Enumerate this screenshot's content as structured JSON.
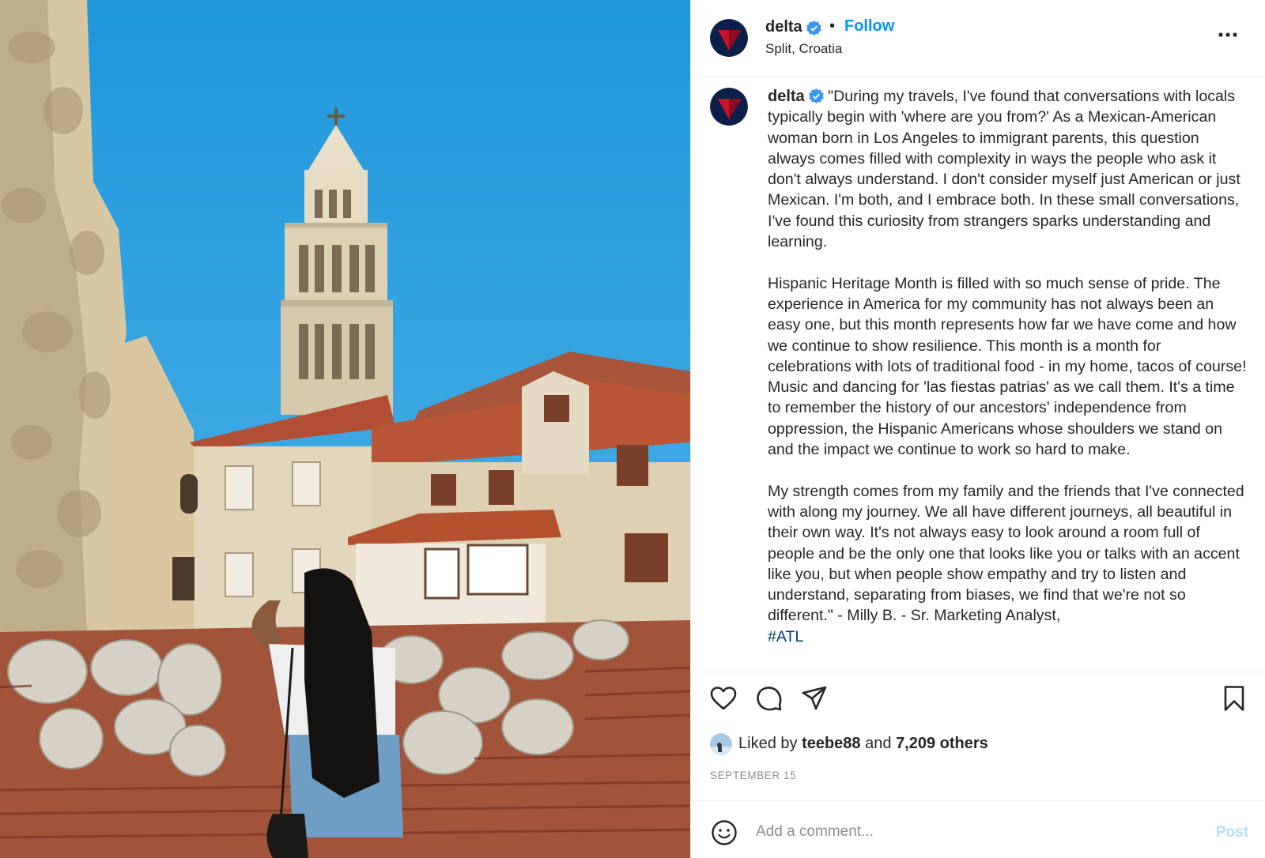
{
  "post": {
    "username": "delta",
    "verified_icon": "verified-badge-icon",
    "separator": "•",
    "follow_label": "Follow",
    "location": "Split, Croatia",
    "more_icon": "more-options-icon",
    "caption_paragraphs": [
      "\"During my travels, I've found that conversations with locals typically begin with 'where are you from?' As a Mexican-American woman born in Los Angeles to immigrant parents, this question always comes filled with complexity in ways the people who ask it don't always understand. I don't consider myself just American or just Mexican. I'm both, and I embrace both. In these small conversations, I've found this curiosity from strangers sparks understanding and learning.",
      "Hispanic Heritage Month is filled with so much sense of pride. The experience in America for my community has not always been an easy one, but this month represents how far we have come and how we continue to show resilience. This month is a month for celebrations with lots of traditional food - in my home, tacos of course! Music and dancing for 'las fiestas patrias' as we call them. It's a time to remember the history of our ancestors' independence from oppression, the Hispanic Americans whose shoulders we stand on and the impact we continue to work so hard to make.",
      "My strength comes from my family and the friends that I've connected with along my journey. We all have different journeys, all beautiful in their own way. It's not always easy to look around a room full of people and be the only one that looks like you or talks with an accent like you, but when people show empathy and try to listen and understand, separating from biases, we find that we're not so different.\" - Milly B. - Sr. Marketing Analyst,"
    ],
    "hashtag": "#ATL",
    "likes": {
      "prefix": "Liked by",
      "user": "teebe88",
      "conjunction": "and",
      "others": "7,209 others"
    },
    "date": "SEPTEMBER 15",
    "comment": {
      "placeholder": "Add a comment...",
      "value": "",
      "post_label": "Post"
    },
    "icons": {
      "like": "heart-icon",
      "comment": "comment-icon",
      "share": "share-icon",
      "save": "bookmark-icon",
      "emoji": "emoji-icon"
    },
    "colors": {
      "link_blue": "#0095f6",
      "hashtag": "#00376b",
      "muted": "#8e8e8e",
      "post_disabled": "#b2dffc",
      "delta_red": "#c8102e",
      "delta_navy": "#0b1f48"
    }
  }
}
